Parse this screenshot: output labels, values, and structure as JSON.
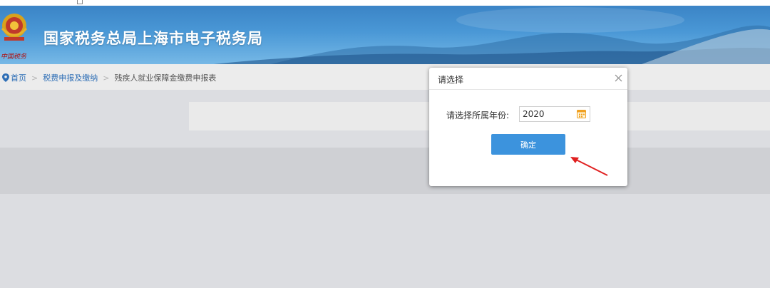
{
  "header": {
    "site_title": "国家税务总局上海市电子税务局",
    "emblem_icon": "tax-emblem-icon",
    "emblem_caption_handwritten": "中国税务"
  },
  "breadcrumb": {
    "items": [
      {
        "label": "首页",
        "icon": "location-pin-icon"
      },
      {
        "label": "税费申报及缴纳"
      },
      {
        "label": "残疾人就业保障金缴费申报表"
      }
    ],
    "separator": ">"
  },
  "dialog": {
    "title": "请选择",
    "close_icon": "close-icon",
    "year_label": "请选择所属年份:",
    "year_value": "2020",
    "calendar_icon": "calendar-icon",
    "confirm_label": "确定"
  },
  "annotation": {
    "arrow_color": "#e02020"
  },
  "colors": {
    "banner_blue": "#3b84c6",
    "link_blue": "#2f6fb6",
    "button_blue": "#3c93dd",
    "calendar_orange": "#f0a020"
  }
}
